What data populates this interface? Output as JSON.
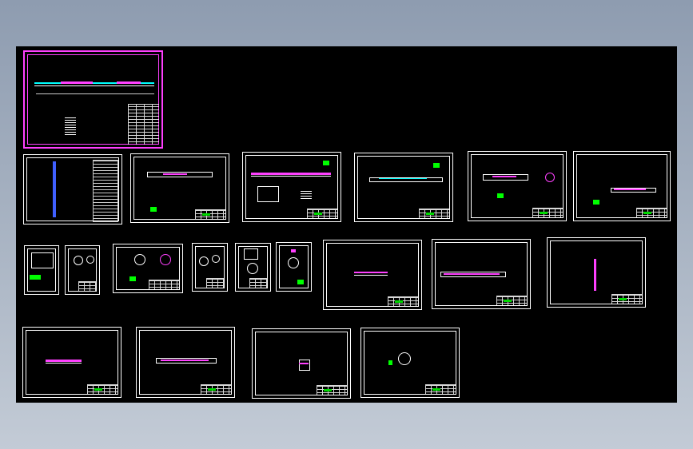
{
  "app": {
    "background": "#000000",
    "accent_selected": "#ff40ff",
    "frame_color": "#ffffff",
    "highlight_colors": [
      "#ff40ff",
      "#00ffff",
      "#00ff00",
      "#4060ff"
    ]
  },
  "sheets": [
    {
      "id": "sheet-1",
      "selected": true
    },
    {
      "id": "sheet-2"
    },
    {
      "id": "sheet-3"
    },
    {
      "id": "sheet-4"
    },
    {
      "id": "sheet-5"
    },
    {
      "id": "sheet-6"
    },
    {
      "id": "sheet-7"
    },
    {
      "id": "sheet-8"
    },
    {
      "id": "sheet-9"
    },
    {
      "id": "sheet-10"
    },
    {
      "id": "sheet-11"
    },
    {
      "id": "sheet-12"
    },
    {
      "id": "sheet-13"
    },
    {
      "id": "sheet-14"
    },
    {
      "id": "sheet-15"
    },
    {
      "id": "sheet-16"
    },
    {
      "id": "sheet-17"
    },
    {
      "id": "sheet-18"
    },
    {
      "id": "sheet-19"
    },
    {
      "id": "sheet-20"
    }
  ]
}
